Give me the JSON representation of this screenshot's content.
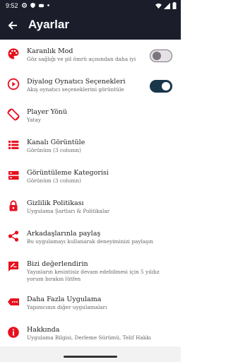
{
  "status": {
    "time": "9:52"
  },
  "header": {
    "title": "Ayarlar"
  },
  "colors": {
    "accent": "#e8101e",
    "appbar": "#1b1d2b",
    "toggle_on": "#19364b"
  },
  "items": [
    {
      "label": "Karanlık Mod",
      "sub": "Göz sağlığı ve pil ömrü açısından daha iyi",
      "icon": "palette-icon",
      "toggle": "off"
    },
    {
      "label": "Diyalog Oynatıcı Seçenekleri",
      "sub": "Akış oynatıcı seçeneklerini görüntüle",
      "icon": "play-circle-icon",
      "toggle": "on"
    },
    {
      "label": "Player Yönü",
      "sub": "Yatay",
      "icon": "screen-rotation-icon"
    },
    {
      "label": "Kanalı Görüntüle",
      "sub": "Görünüm (3 column)",
      "icon": "view-list-icon"
    },
    {
      "label": "Görüntüleme Kategorisi",
      "sub": "Görünüm (3 column)",
      "icon": "view-stream-icon"
    },
    {
      "label": "Gizlilik Politikası",
      "sub": "Uygulama Şartları & Politikalar",
      "icon": "lock-icon"
    },
    {
      "label": "Arkadaşlarınla paylaş",
      "sub": "Bu uygulamayı kullanarak deneyiminizi paylaşın",
      "icon": "share-icon"
    },
    {
      "label": "Bizi değerlendirin",
      "sub": "Yayınların kesintisiz devam edebilmesi için 5 yıldız yorum bırakın lütfen",
      "icon": "rate-review-icon"
    },
    {
      "label": "Daha Fazla Uygulama",
      "sub": "Yapımcının diğer uygulamaları",
      "icon": "more-apps-tag-icon"
    },
    {
      "label": "Hakkında",
      "sub": "Uygulama Bilgisi, Derleme Sürümü, Telif Hakkı",
      "icon": "info-icon"
    }
  ]
}
